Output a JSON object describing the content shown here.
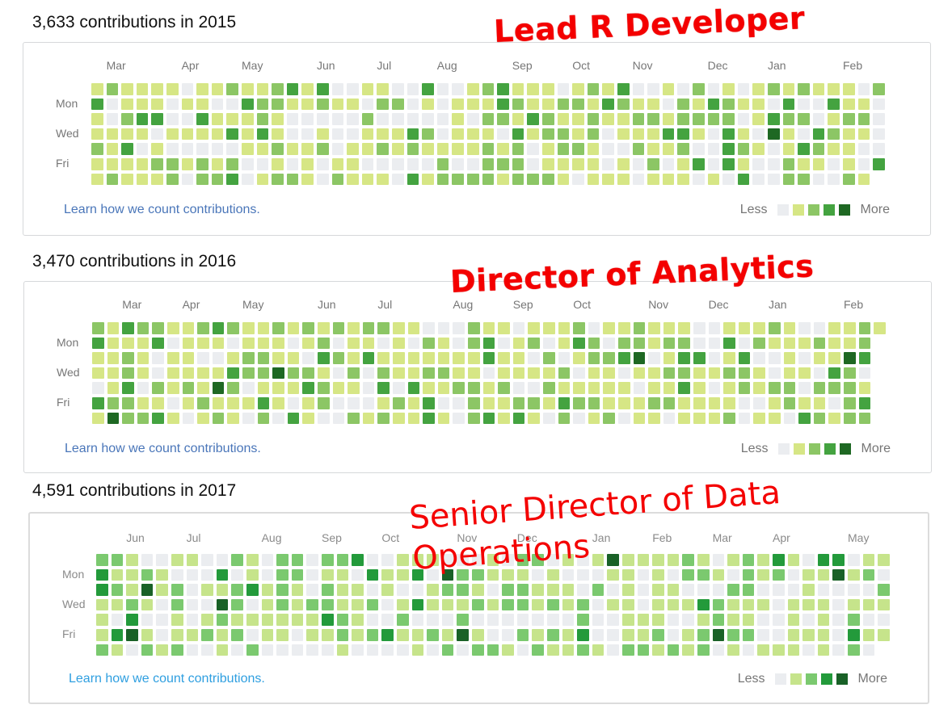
{
  "panels": [
    {
      "id": "2015",
      "heading": "3,633 contributions in 2015",
      "months": [
        {
          "label": "Mar",
          "col": 1
        },
        {
          "label": "Apr",
          "col": 6
        },
        {
          "label": "May",
          "col": 10
        },
        {
          "label": "Jun",
          "col": 15
        },
        {
          "label": "Jul",
          "col": 19
        },
        {
          "label": "Aug",
          "col": 23
        },
        {
          "label": "Sep",
          "col": 28
        },
        {
          "label": "Oct",
          "col": 32
        },
        {
          "label": "Nov",
          "col": 36
        },
        {
          "label": "Dec",
          "col": 41
        },
        {
          "label": "Jan",
          "col": 45
        },
        {
          "label": "Feb",
          "col": 50
        }
      ],
      "days": [
        {
          "label": "Mon",
          "row": 1
        },
        {
          "label": "Wed",
          "row": 3
        },
        {
          "label": "Fri",
          "row": 5
        }
      ],
      "learn_link": "Learn how we count contributions.",
      "legend": {
        "less": "Less",
        "more": "More"
      },
      "annotation": "Lead R Developer"
    },
    {
      "id": "2016",
      "heading": "3,470 contributions in 2016",
      "months": [
        {
          "label": "Mar",
          "col": 2
        },
        {
          "label": "Apr",
          "col": 6
        },
        {
          "label": "May",
          "col": 10
        },
        {
          "label": "Jun",
          "col": 15
        },
        {
          "label": "Jul",
          "col": 19
        },
        {
          "label": "Aug",
          "col": 24
        },
        {
          "label": "Sep",
          "col": 28
        },
        {
          "label": "Oct",
          "col": 32
        },
        {
          "label": "Nov",
          "col": 37
        },
        {
          "label": "Dec",
          "col": 41
        },
        {
          "label": "Jan",
          "col": 45
        },
        {
          "label": "Feb",
          "col": 50
        }
      ],
      "days": [
        {
          "label": "Mon",
          "row": 1
        },
        {
          "label": "Wed",
          "row": 3
        },
        {
          "label": "Fri",
          "row": 5
        }
      ],
      "learn_link": "Learn how we count contributions.",
      "legend": {
        "less": "Less",
        "more": "More"
      },
      "annotation": "Director of Analytics"
    },
    {
      "id": "2017",
      "heading": "4,591 contributions in 2017",
      "months": [
        {
          "label": "Jun",
          "col": 2
        },
        {
          "label": "Jul",
          "col": 6
        },
        {
          "label": "Aug",
          "col": 11
        },
        {
          "label": "Sep",
          "col": 15
        },
        {
          "label": "Oct",
          "col": 19
        },
        {
          "label": "Nov",
          "col": 24
        },
        {
          "label": "Dec",
          "col": 28
        },
        {
          "label": "Jan",
          "col": 33
        },
        {
          "label": "Feb",
          "col": 37
        },
        {
          "label": "Mar",
          "col": 41
        },
        {
          "label": "Apr",
          "col": 45
        },
        {
          "label": "May",
          "col": 50
        }
      ],
      "days": [
        {
          "label": "Mon",
          "row": 1
        },
        {
          "label": "Wed",
          "row": 3
        },
        {
          "label": "Fri",
          "row": 5
        }
      ],
      "learn_link": "Learn how we count contributions.",
      "legend": {
        "less": "Less",
        "more": "More"
      },
      "annotation_line1": "Senior Director of Data",
      "annotation_line2": "Operations"
    }
  ],
  "colors": {
    "level0": "#ebedf0",
    "level1": "#d6e685",
    "level2": "#8cc665",
    "level3": "#44a340",
    "level4": "#1e6823",
    "level1_2017": "#c6e48b",
    "level2_2017": "#7bc96f",
    "level3_2017": "#239a3b",
    "level4_2017": "#196127",
    "annotation": "#f40000",
    "link": "#4a76b9"
  }
}
